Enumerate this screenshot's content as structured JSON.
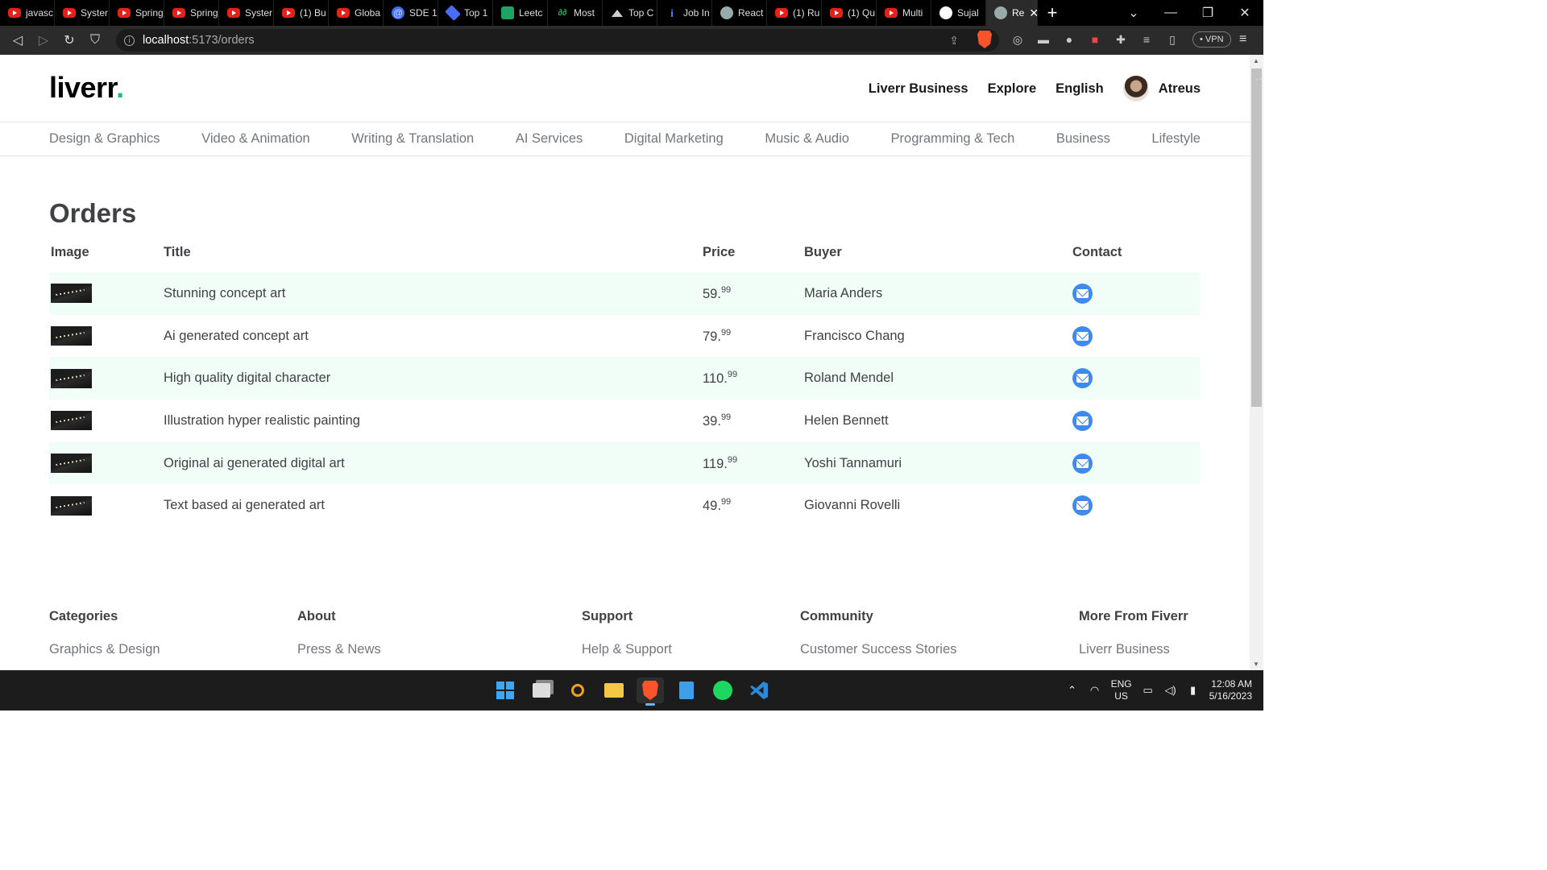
{
  "browser": {
    "tabs": [
      {
        "title": "javasc",
        "icon": "youtube-icon"
      },
      {
        "title": "Syster",
        "icon": "youtube-icon"
      },
      {
        "title": "Spring",
        "icon": "youtube-icon"
      },
      {
        "title": "Spring",
        "icon": "youtube-icon"
      },
      {
        "title": "Syster",
        "icon": "youtube-icon"
      },
      {
        "title": "(1) Bu",
        "icon": "youtube-icon"
      },
      {
        "title": "Globa",
        "icon": "youtube-icon"
      },
      {
        "title": "SDE 1",
        "icon": "at-icon"
      },
      {
        "title": "Top 1",
        "icon": "diamond-icon"
      },
      {
        "title": "Leetc",
        "icon": "sheets-icon"
      },
      {
        "title": "Most",
        "icon": "gfg-icon"
      },
      {
        "title": "Top C",
        "icon": "mountain-icon"
      },
      {
        "title": "Job In",
        "icon": "info-icon"
      },
      {
        "title": "React",
        "icon": "globe-icon"
      },
      {
        "title": "(1) Ru",
        "icon": "youtube-icon"
      },
      {
        "title": "(1) Qu",
        "icon": "youtube-icon"
      },
      {
        "title": "Multi",
        "icon": "youtube-icon"
      },
      {
        "title": "Sujal",
        "icon": "github-icon"
      }
    ],
    "active_tab": {
      "title": "Re",
      "icon": "globe-icon"
    },
    "url_host": "localhost",
    "url_path": ":5173/orders",
    "vpn_label": "VPN"
  },
  "site": {
    "logo": "liverr",
    "logo_dot": ".",
    "nav": {
      "business": "Liverr Business",
      "explore": "Explore",
      "language": "English",
      "username": "Atreus"
    },
    "categories": [
      "Design & Graphics",
      "Video & Animation",
      "Writing & Translation",
      "AI Services",
      "Digital Marketing",
      "Music & Audio",
      "Programming & Tech",
      "Business",
      "Lifestyle"
    ]
  },
  "orders": {
    "title": "Orders",
    "columns": {
      "image": "Image",
      "title": "Title",
      "price": "Price",
      "buyer": "Buyer",
      "contact": "Contact"
    },
    "rows": [
      {
        "title": "Stunning concept art",
        "price_whole": "59.",
        "price_cents": "99",
        "buyer": "Maria Anders"
      },
      {
        "title": "Ai generated concept art",
        "price_whole": "79.",
        "price_cents": "99",
        "buyer": "Francisco Chang"
      },
      {
        "title": "High quality digital character",
        "price_whole": "110.",
        "price_cents": "99",
        "buyer": "Roland Mendel"
      },
      {
        "title": "Illustration hyper realistic painting",
        "price_whole": "39.",
        "price_cents": "99",
        "buyer": "Helen Bennett"
      },
      {
        "title": "Original ai generated digital art",
        "price_whole": "119.",
        "price_cents": "99",
        "buyer": "Yoshi Tannamuri"
      },
      {
        "title": "Text based ai generated art",
        "price_whole": "49.",
        "price_cents": "99",
        "buyer": "Giovanni Rovelli"
      }
    ]
  },
  "footer": {
    "columns": [
      {
        "heading": "Categories",
        "first_link": "Graphics & Design"
      },
      {
        "heading": "About",
        "first_link": "Press & News"
      },
      {
        "heading": "Support",
        "first_link": "Help & Support"
      },
      {
        "heading": "Community",
        "first_link": "Customer Success Stories"
      },
      {
        "heading": "More From Fiverr",
        "first_link": "Liverr Business"
      }
    ]
  },
  "taskbar": {
    "lang_top": "ENG",
    "lang_bottom": "US",
    "time": "12:08 AM",
    "date": "5/16/2023"
  },
  "colors": {
    "accent_green": "#1dbf73",
    "row_highlight": "#f1fdf7",
    "contact_blue": "#3e8bf0"
  }
}
